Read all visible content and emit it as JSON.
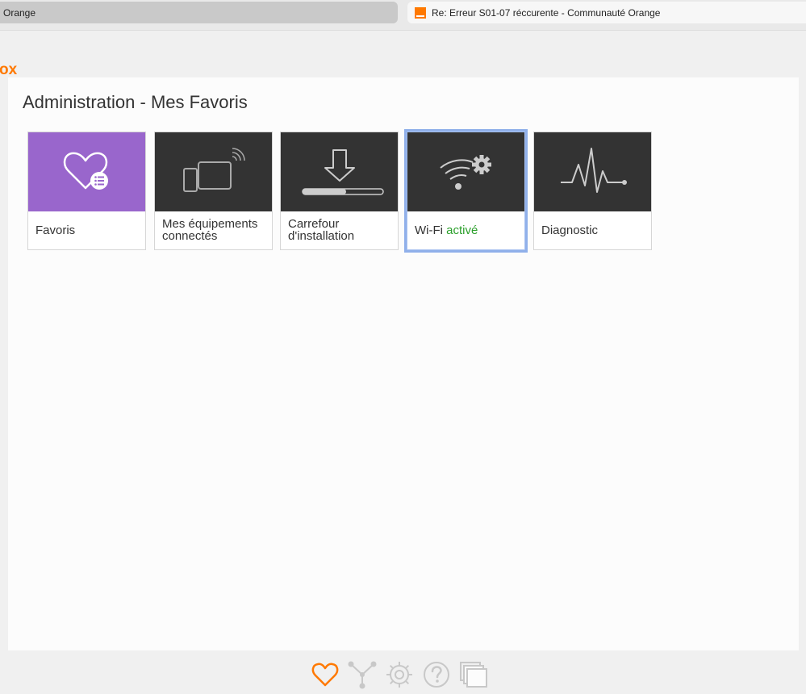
{
  "browser": {
    "tabs": [
      {
        "title": "Orange",
        "active": false
      },
      {
        "title": "Re: Erreur S01-07 réccurente - Communauté Orange",
        "active": true
      }
    ]
  },
  "brand": {
    "logo_fragment": "ox",
    "accent_color": "#ff7900"
  },
  "page": {
    "title": "Administration - Mes Favoris"
  },
  "tiles": [
    {
      "label": "Favoris",
      "icon": "heart-list-icon",
      "background": "#9966cc"
    },
    {
      "label": "Mes équipements connectés",
      "icon": "connected-devices-icon",
      "background": "#333333"
    },
    {
      "label": "Carrefour d'installation",
      "icon": "download-install-icon",
      "background": "#333333"
    },
    {
      "label": "Wi-Fi",
      "status": "activé",
      "status_color": "#2ca02c",
      "icon": "wifi-settings-icon",
      "background": "#333333",
      "selected": true
    },
    {
      "label": "Diagnostic",
      "icon": "pulse-icon",
      "background": "#333333"
    }
  ],
  "bottom_nav": [
    {
      "icon": "heart-icon",
      "active": true
    },
    {
      "icon": "network-icon"
    },
    {
      "icon": "gear-icon"
    },
    {
      "icon": "help-icon"
    },
    {
      "icon": "windows-icon"
    }
  ]
}
